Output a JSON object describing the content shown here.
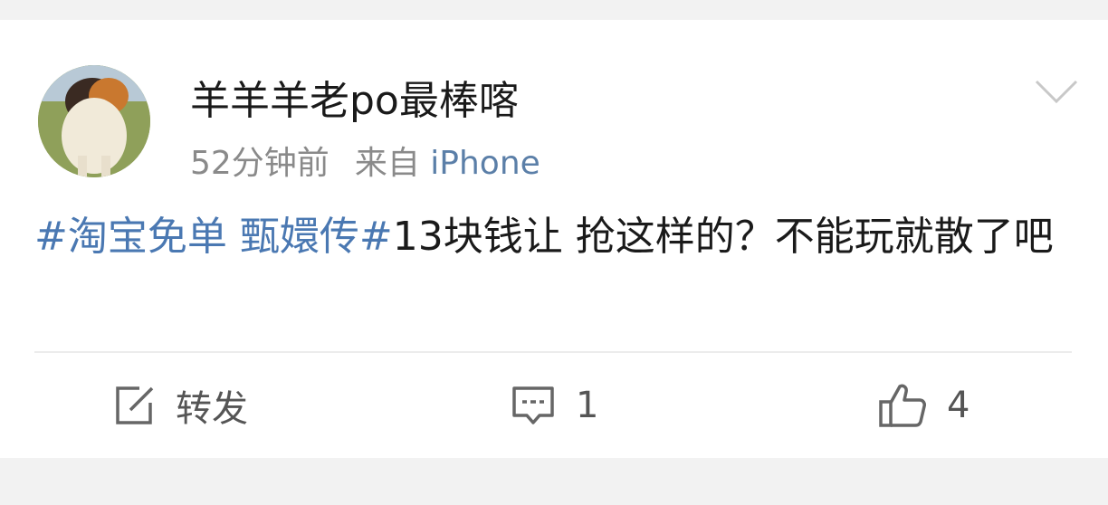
{
  "post": {
    "username": "羊羊羊老po最棒喀",
    "time": "52分钟前",
    "source_prefix": "来自",
    "source_device": "iPhone",
    "hashtag": "#淘宝免单 甄嬛传#",
    "text": "13块钱让 抢这样的？不能玩就散了吧"
  },
  "actions": {
    "repost_label": "转发",
    "comment_count": "1",
    "like_count": "4"
  },
  "colors": {
    "hashtag": "#4a78b2",
    "source_device": "#5b7fa8",
    "meta": "#8a8a8a",
    "icon": "#666666"
  },
  "icons": {
    "menu": "chevron-down-icon",
    "repost": "share-edit-icon",
    "comment": "comment-icon",
    "like": "thumbs-up-icon"
  }
}
